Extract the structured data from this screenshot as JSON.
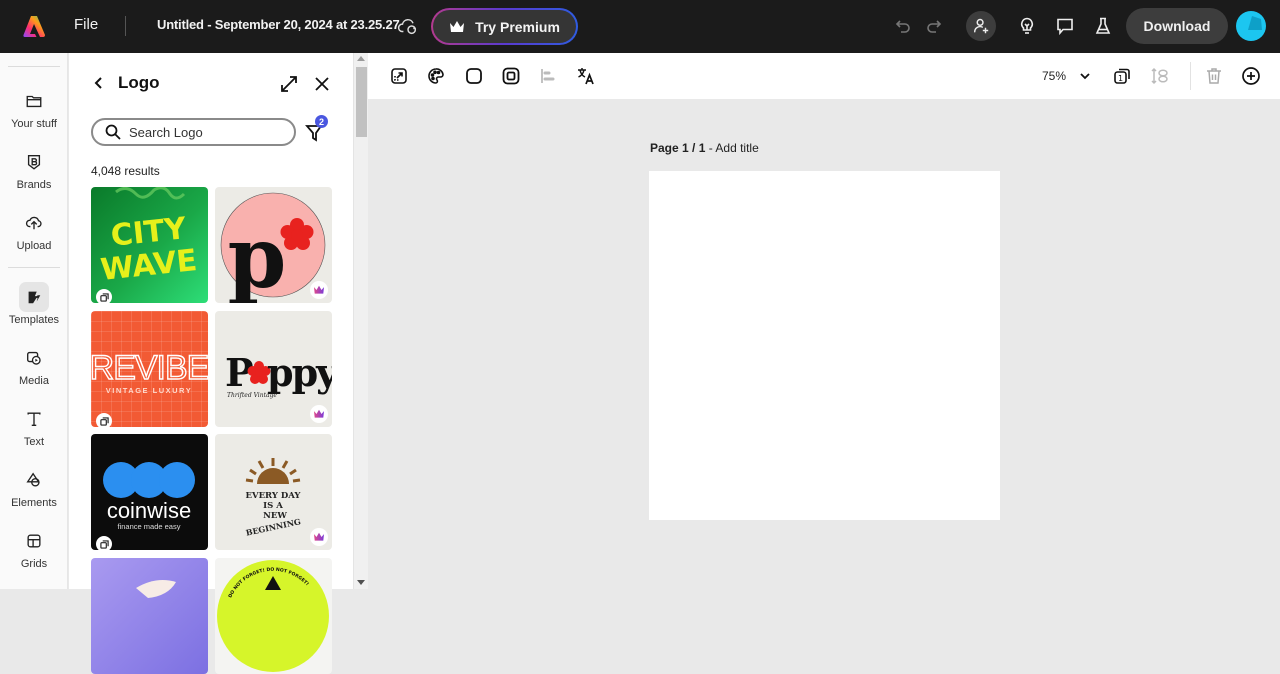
{
  "topbar": {
    "file_label": "File",
    "doc_title": "Untitled - September 20, 2024 at 23.25.27",
    "premium_label": "Try Premium",
    "download_label": "Download",
    "icons": [
      "app-logo",
      "cloud-sync-icon",
      "crown-icon",
      "undo-icon",
      "redo-icon",
      "invite-user-icon",
      "lightbulb-icon",
      "comment-icon",
      "flask-icon",
      "avatar"
    ]
  },
  "rail": {
    "items": [
      {
        "label": "Your stuff",
        "icon": "folder-icon"
      },
      {
        "label": "Brands",
        "icon": "brand-icon"
      },
      {
        "label": "Upload",
        "icon": "upload-icon"
      },
      {
        "label": "Templates",
        "icon": "templates-icon",
        "active": true
      },
      {
        "label": "Media",
        "icon": "media-icon"
      },
      {
        "label": "Text",
        "icon": "text-icon"
      },
      {
        "label": "Elements",
        "icon": "elements-icon"
      },
      {
        "label": "Grids",
        "icon": "grids-icon"
      }
    ]
  },
  "panel": {
    "title": "Logo",
    "search_placeholder": "Search Logo",
    "filter_count": "2",
    "results": "4,048 results",
    "templates": [
      {
        "name": "City Wave",
        "line1": "CITY",
        "line2": "WAVE",
        "premium": false
      },
      {
        "name": "P flower",
        "line1": "p",
        "premium": true
      },
      {
        "name": "Revibe",
        "line1": "REVIBE",
        "line2": "VINTAGE LUXURY",
        "premium": false
      },
      {
        "name": "Poppy",
        "line1": "P",
        "line2": "ppy",
        "line3": "Thrifted Vintage",
        "premium": true
      },
      {
        "name": "Coinwise",
        "line1": "coinwise",
        "line2": "finance made easy",
        "premium": false
      },
      {
        "name": "Every Day",
        "line1": "EVERY DAY",
        "line2": "IS A",
        "line3": "NEW",
        "line4": "BEGINNING",
        "premium": true
      },
      {
        "name": "Purple leaf",
        "premium": false
      },
      {
        "name": "Do not forget",
        "line1": "DO NOT FORGET! DO NOT FORGET!",
        "premium": false
      }
    ]
  },
  "canvas_toolbar": {
    "zoom": "75%",
    "page_count": "1",
    "icons": [
      "resize-icon",
      "palette-icon",
      "rounded-square-icon",
      "border-icon",
      "align-icon",
      "translate-icon",
      "pages-icon",
      "arrange-icon",
      "trash-icon",
      "add-icon"
    ]
  },
  "canvas": {
    "page_label": "Page 1 / 1",
    "page_separator": " - ",
    "add_title": "Add title"
  },
  "colors": {
    "topbar_bg": "#1b1b1b",
    "accent_badge": "#4a57e0",
    "avatar": "#1cc6f0",
    "canvas_bg": "#e9e9e9"
  }
}
